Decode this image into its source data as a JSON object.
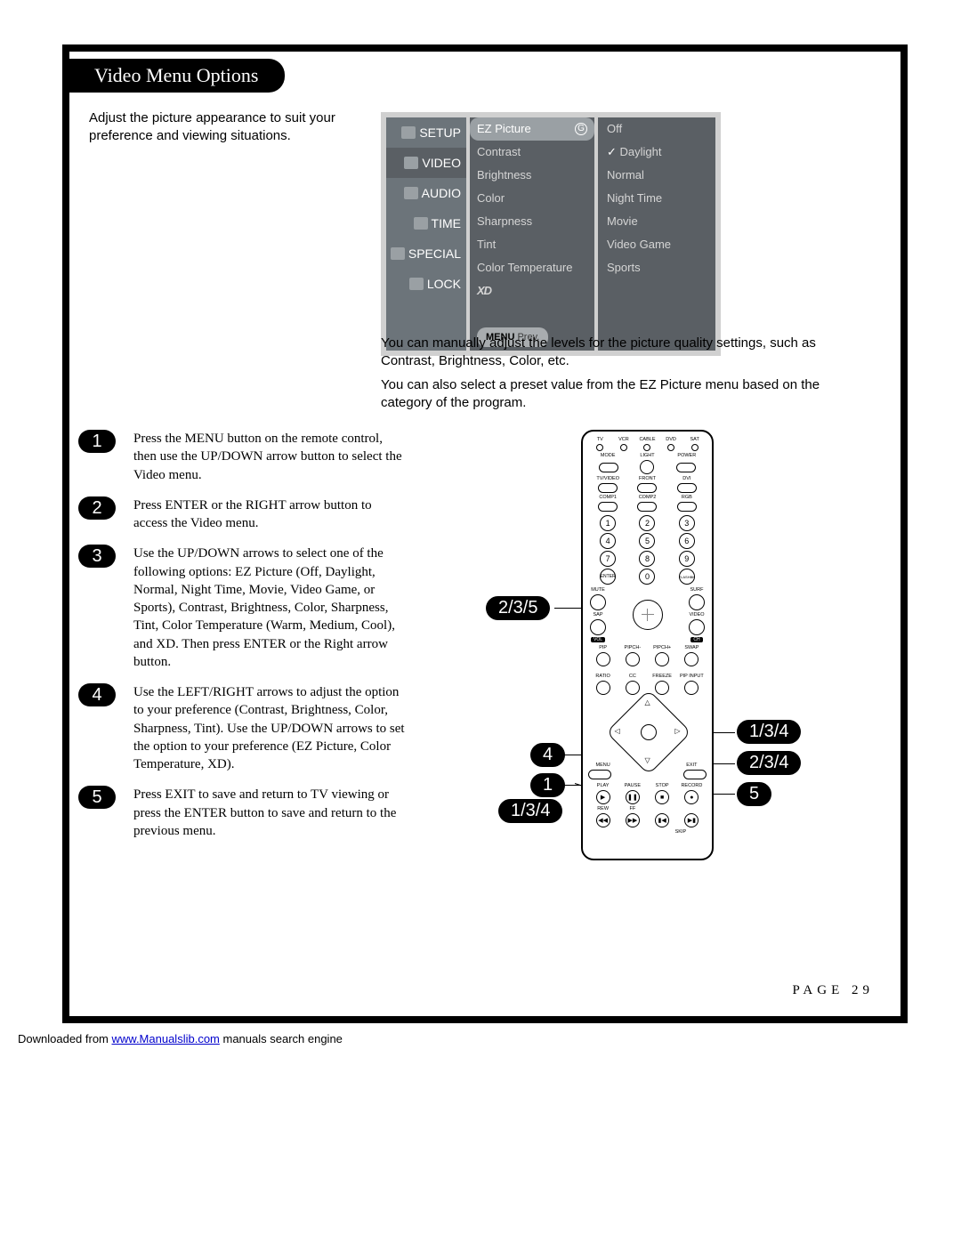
{
  "title": "Video Menu Options",
  "intro": "Adjust the picture appearance to suit your preference and viewing situations.",
  "osd": {
    "left": [
      "SETUP",
      "VIDEO",
      "AUDIO",
      "TIME",
      "SPECIAL",
      "LOCK"
    ],
    "mid_highlight": "EZ Picture",
    "mid_highlight_icon": "G",
    "mid": [
      "Contrast",
      "Brightness",
      "Color",
      "Sharpness",
      "Tint",
      "Color Temperature"
    ],
    "mid_logo": "XD",
    "right": [
      "Off",
      "Daylight",
      "Normal",
      "Night Time",
      "Movie",
      "Video Game",
      "Sports"
    ],
    "right_checked_index": 1,
    "bottom_menu": "MENU",
    "bottom_prev": "Prev."
  },
  "para1": "You can manually adjust the levels for the picture quality settings, such as Contrast, Brightness, Color, etc.",
  "para2": "You can also select a preset value from the EZ Picture menu based on the category of the program.",
  "steps": [
    {
      "n": "1",
      "t": "Press the MENU button on the remote control, then use the UP/DOWN arrow button to select the Video menu."
    },
    {
      "n": "2",
      "t": "Press ENTER or the RIGHT arrow button to access the Video menu."
    },
    {
      "n": "3",
      "t": "Use the UP/DOWN arrows to select one of the following options: EZ Picture (Off, Daylight, Normal, Night Time, Movie, Video Game, or Sports), Contrast, Brightness, Color, Sharpness, Tint, Color Temperature (Warm, Medium, Cool), and XD. Then press ENTER or the Right arrow button."
    },
    {
      "n": "4",
      "t": "Use the LEFT/RIGHT arrows to adjust the option to your preference (Contrast, Brightness, Color, Sharpness, Tint). Use the UP/DOWN arrows to set the option to your preference (EZ Picture, Color Temperature, XD)."
    },
    {
      "n": "5",
      "t": "Press EXIT to save and return to TV viewing or press the ENTER button to save and return to the previous menu."
    }
  ],
  "callouts": {
    "enter": "2/3/5",
    "left": "4",
    "menu": "1",
    "down": "1/3/4",
    "up": "1/3/4",
    "right": "2/3/4",
    "exit": "5"
  },
  "remote": {
    "row1_labels": [
      "TV",
      "VCR",
      "CABLE",
      "DVD",
      "SAT"
    ],
    "row2_labels": [
      "MODE",
      "LIGHT",
      "POWER"
    ],
    "row3_labels": [
      "TV/VIDEO",
      "FRONT",
      "DVI"
    ],
    "row4_labels": [
      "COMP1",
      "COMP2",
      "RGB"
    ],
    "numpad": [
      [
        "1",
        "2",
        "3"
      ],
      [
        "4",
        "5",
        "6"
      ],
      [
        "7",
        "8",
        "9"
      ]
    ],
    "numpad_bottom": [
      "ENTER",
      "0",
      "FLASHBK"
    ],
    "rockers": {
      "left_top": "MUTE",
      "left_bottom": "SAP",
      "left_lbl": "VOL",
      "right_top": "SURF",
      "right_bottom": "VIDEO",
      "right_lbl": "CH"
    },
    "row_pip": [
      "PIP",
      "PIPCH-",
      "PIPCH+",
      "SWAP"
    ],
    "row_ratio": [
      "RATIO",
      "CC",
      "FREEZE",
      "PIP INPUT"
    ],
    "dpad": {
      "menu": "MENU",
      "exit": "EXIT"
    },
    "trans_row1": [
      "PLAY",
      "PAUSE",
      "STOP",
      "RECORD"
    ],
    "trans_row2": [
      "REW",
      "FF",
      "",
      ""
    ],
    "skip": "SKIP"
  },
  "page_number": "PAGE 29",
  "footer_pre": "Downloaded from ",
  "footer_link": "www.Manualslib.com",
  "footer_post": " manuals search engine"
}
